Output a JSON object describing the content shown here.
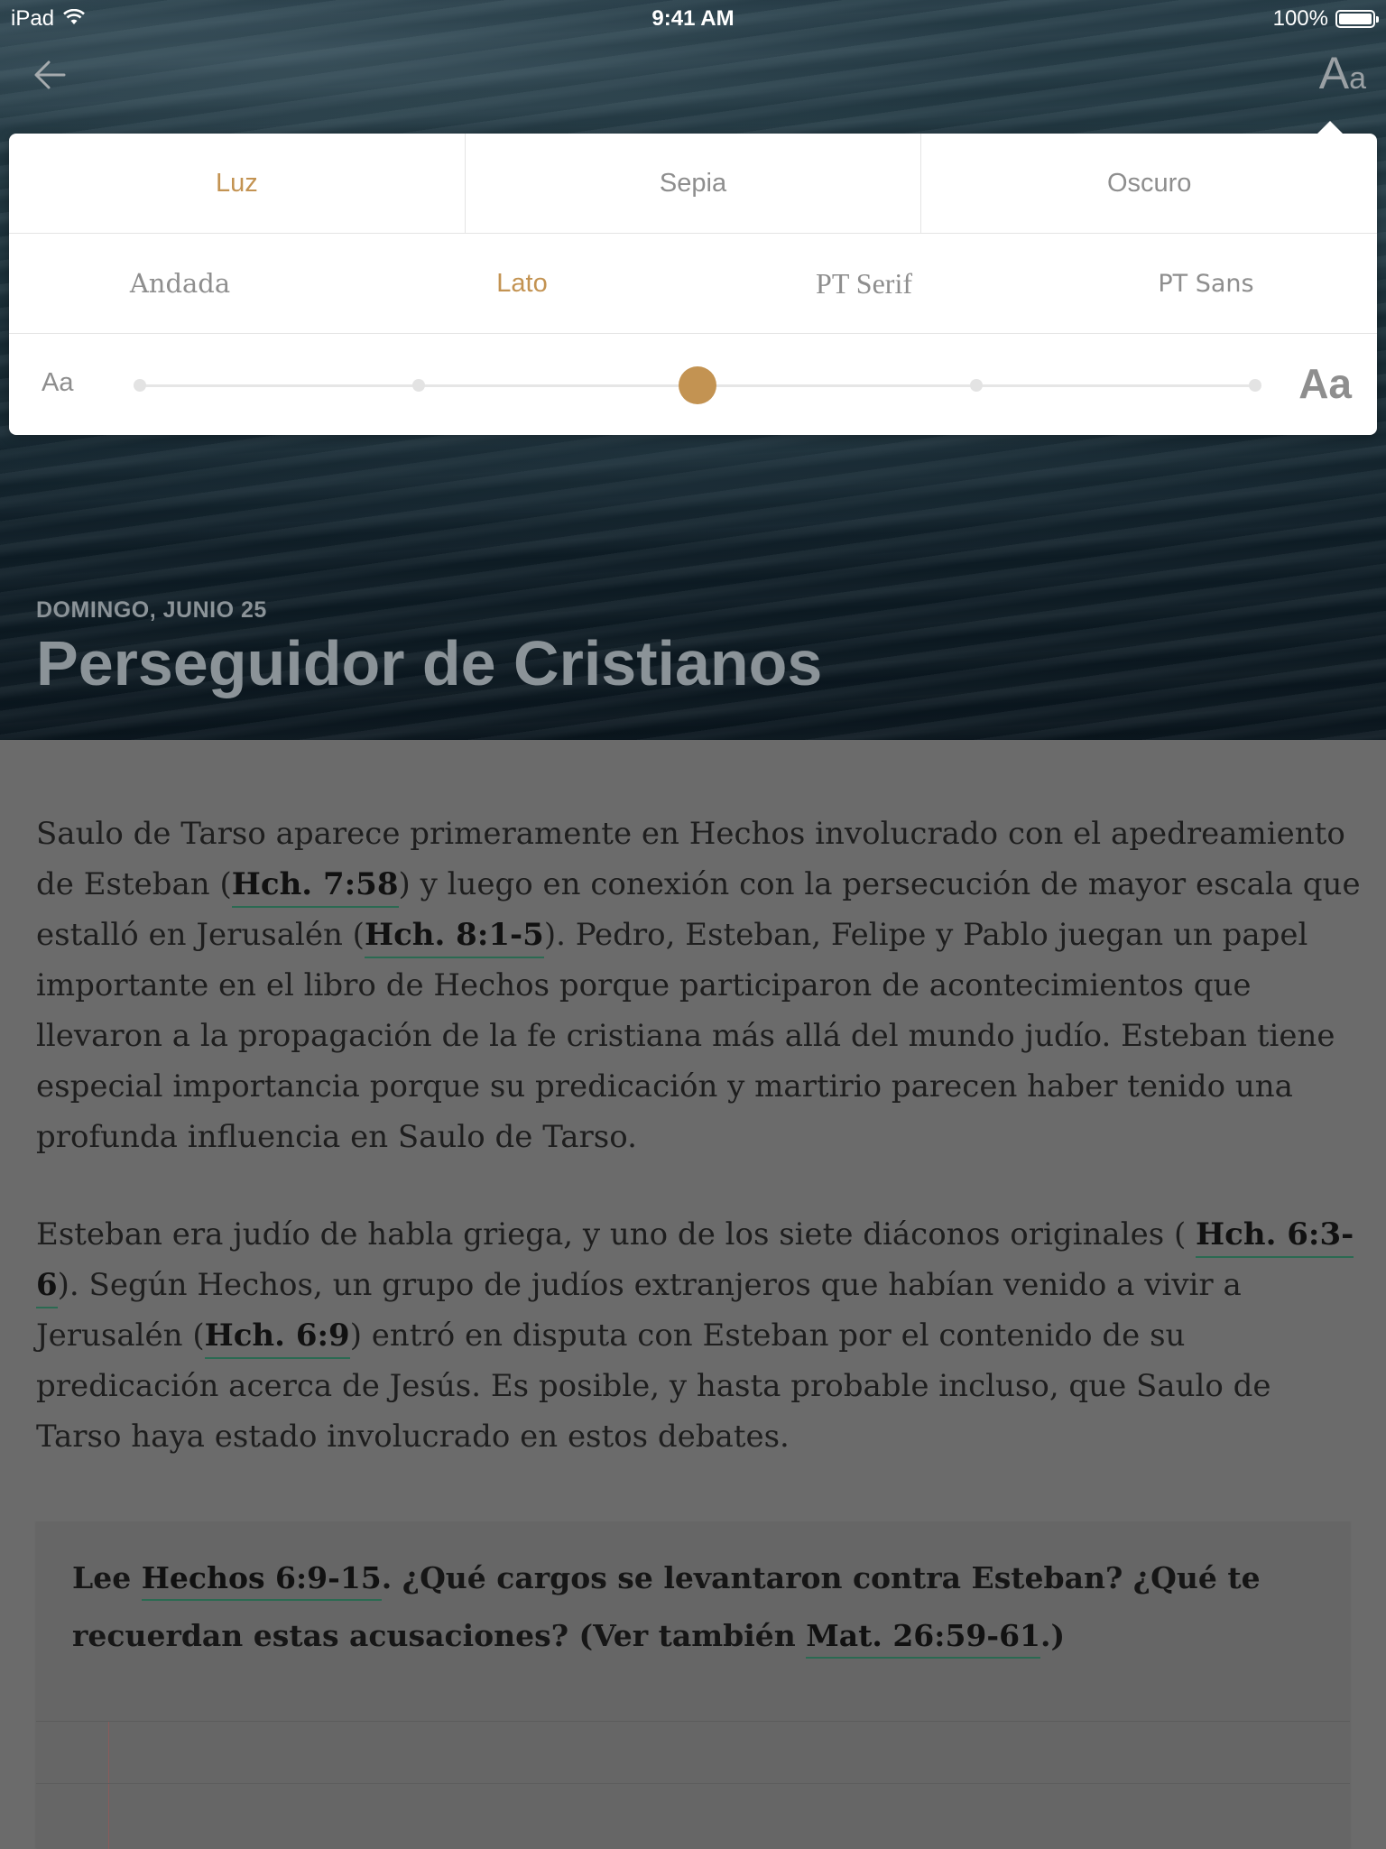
{
  "status_bar": {
    "device": "iPad",
    "time": "9:41 AM",
    "battery": "100%"
  },
  "nav": {
    "back_icon": "arrow-left-icon",
    "font_settings_big": "A",
    "font_settings_small": "a"
  },
  "settings": {
    "themes": [
      "Luz",
      "Sepia",
      "Oscuro"
    ],
    "active_theme": "Luz",
    "fonts": [
      "Andada",
      "Lato",
      "PT Serif",
      "PT Sans"
    ],
    "active_font": "Lato",
    "size_small_label": "Aa",
    "size_large_label": "Aa",
    "size_steps": 5,
    "size_level": 3
  },
  "lesson": {
    "date": "DOMINGO, JUNIO 25",
    "title": "Perseguidor de Cristianos"
  },
  "body": {
    "p1": {
      "t1": "Saulo de Tarso aparece primeramente en Hechos involucrado con el apedreamiento de Esteban (",
      "r1": "Hch. 7:58",
      "t2": ") y luego en conexión con la persecución de mayor escala que estalló en Jerusalén (",
      "r2": "Hch. 8:1-5",
      "t3": "). Pedro, Esteban, Felipe y Pablo juegan un papel importante en el libro de Hechos porque participaron de acontecimientos que llevaron a la propagación de la fe cristiana más allá del mundo judío. Esteban tiene especial importancia porque su predicación y martirio parecen haber tenido una profunda influencia en Saulo de Tarso."
    },
    "p2": {
      "t1": "Esteban era judío de habla griega, y uno de los siete diáconos originales ( ",
      "r1": "Hch. 6:3-6",
      "t2": "). Según Hechos, un grupo de judíos extranjeros que habían venido a vivir a Jerusalén (",
      "r2": "Hch. 6:9",
      "t3": ") entró en disputa con Esteban por el contenido de su predicación acerca de Jesús. Es posible, y hasta probable incluso, que Saulo de Tarso haya estado involucrado en estos debates."
    },
    "question": {
      "t1": "Lee ",
      "r1": "Hechos 6:9-15",
      "t2": ". ¿Qué cargos se levantaron contra Esteban? ¿Qué te recuerdan estas acusaciones? (Ver también ",
      "r2": "Mat. 26:59-61",
      "t3": ".)"
    }
  }
}
